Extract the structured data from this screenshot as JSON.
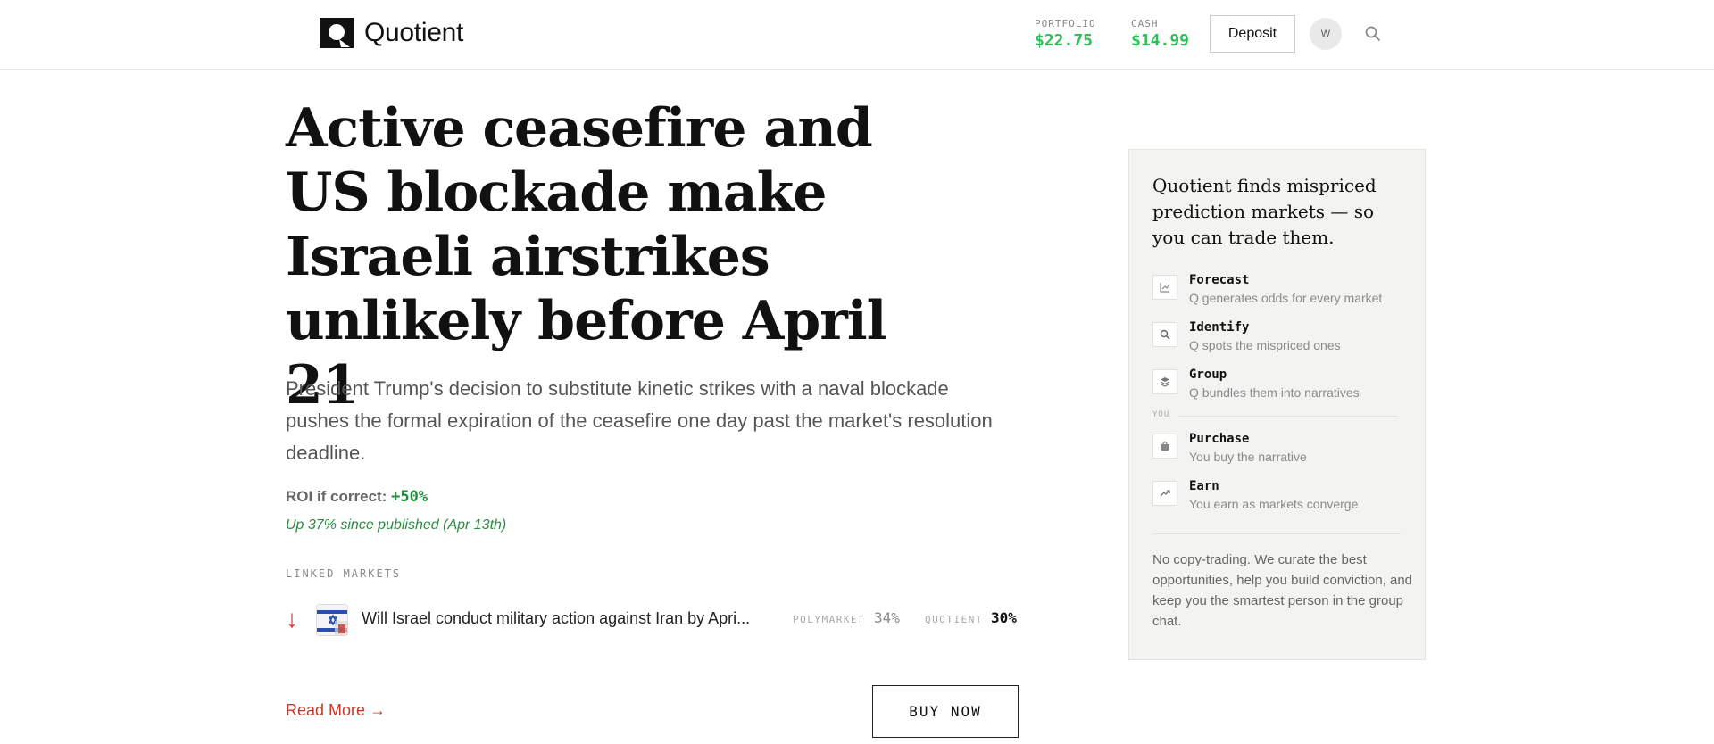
{
  "header": {
    "app_name": "Quotient",
    "portfolio": {
      "label": "PORTFOLIO",
      "value": "$22.75"
    },
    "cash": {
      "label": "CASH",
      "value": "$14.99"
    },
    "deposit_label": "Deposit",
    "avatar_initial": "W",
    "accent_color": "#2fbf5a"
  },
  "article": {
    "title": "Active ceasefire and US blockade make Israeli airstrikes unlikely before April 21",
    "lede": "President Trump's decision to substitute kinetic strikes with a naval blockade pushes the formal expiration of the ceasefire one day past the market's resolution deadline.",
    "roi_label": "ROI if correct:",
    "roi_value": "+50%",
    "since_published": "Up 37% since published (Apr 13th)",
    "linked_markets_label": "LINKED MARKETS",
    "markets": [
      {
        "direction": "down",
        "name": "Will Israel conduct military action against Iran by Apri...",
        "polymarket_label": "POLYMARKET",
        "polymarket_value": "34%",
        "quotient_label": "QUOTIENT",
        "quotient_value": "30%"
      }
    ],
    "read_more": "Read More →",
    "buy_label": "BUY NOW"
  },
  "sidebar": {
    "title": "Quotient finds mispriced prediction markets — so you can trade them.",
    "steps": [
      {
        "name": "Forecast",
        "desc": "Q generates odds for every market",
        "icon": "chart-icon"
      },
      {
        "name": "Identify",
        "desc": "Q spots the mispriced ones",
        "icon": "magnifier-icon"
      },
      {
        "name": "Group",
        "desc": "Q bundles them into narratives",
        "icon": "layers-icon"
      }
    ],
    "you_label": "YOU",
    "user_steps": [
      {
        "name": "Purchase",
        "desc": "You buy the narrative",
        "icon": "basket-icon"
      },
      {
        "name": "Earn",
        "desc": "You earn as markets converge",
        "icon": "trend-up-icon"
      }
    ],
    "footer": "No copy-trading. We curate the best opportunities, help you build conviction, and keep you the smartest person in the group chat."
  }
}
